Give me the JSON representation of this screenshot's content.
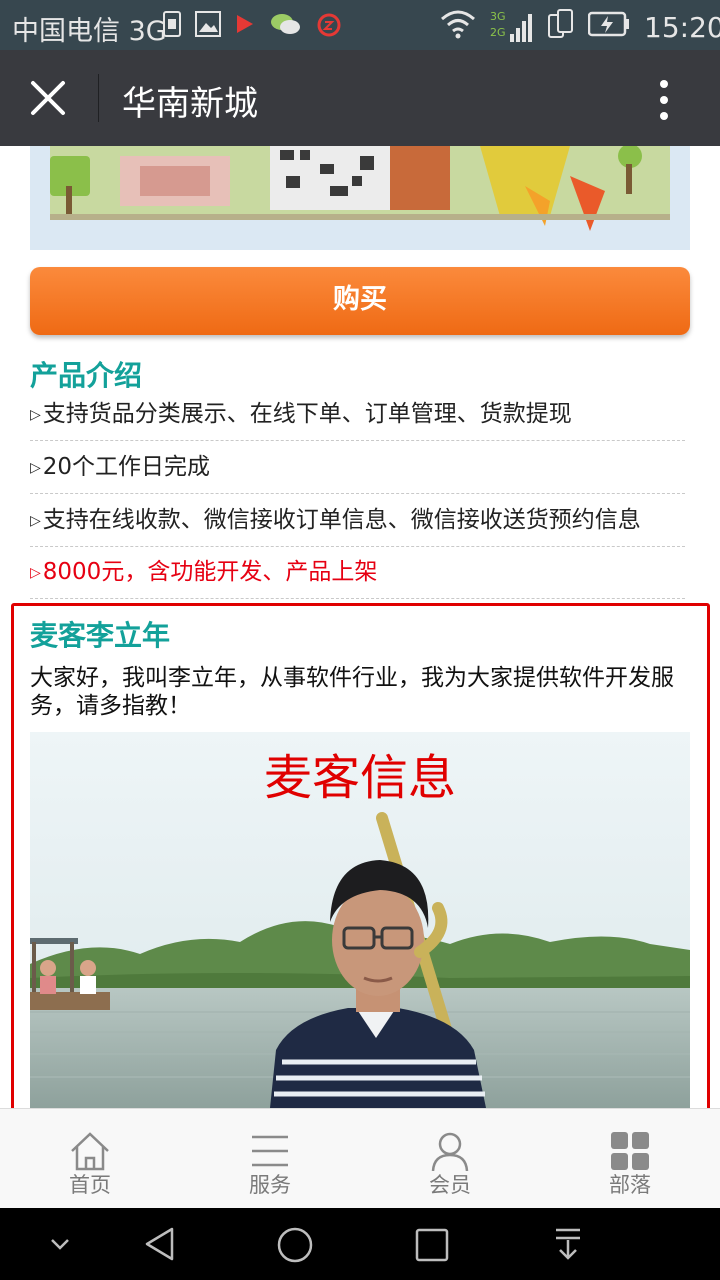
{
  "status_bar": {
    "carrier": "中国电信 3G",
    "network_tag_top": "3G",
    "network_tag_bottom": "2G",
    "time": "15:20"
  },
  "nav": {
    "title": "华南新城"
  },
  "buy_button": {
    "label": "购买"
  },
  "product": {
    "title": "产品介绍",
    "features": [
      "支持货品分类展示、在线下单、订单管理、货款提现",
      "20个工作日完成",
      "支持在线收款、微信接收订单信息、微信接收送货预约信息"
    ],
    "price_note": "8000元，含功能开发、产品上架"
  },
  "maker": {
    "name": "麦客李立年",
    "intro": "大家好，我叫李立年，从事软件行业，我为大家提供软件开发服务，请多指教！",
    "annotation": "麦客信息"
  },
  "tabbar": {
    "items": [
      {
        "label": "首页",
        "icon": "home-icon"
      },
      {
        "label": "服务",
        "icon": "list-icon"
      },
      {
        "label": "会员",
        "icon": "person-icon"
      },
      {
        "label": "部落",
        "icon": "grid-icon"
      }
    ]
  },
  "colors": {
    "accent_teal": "#13a19a",
    "buy_orange": "#f07020",
    "price_red": "#e60012",
    "annotation_red": "#e00000"
  }
}
